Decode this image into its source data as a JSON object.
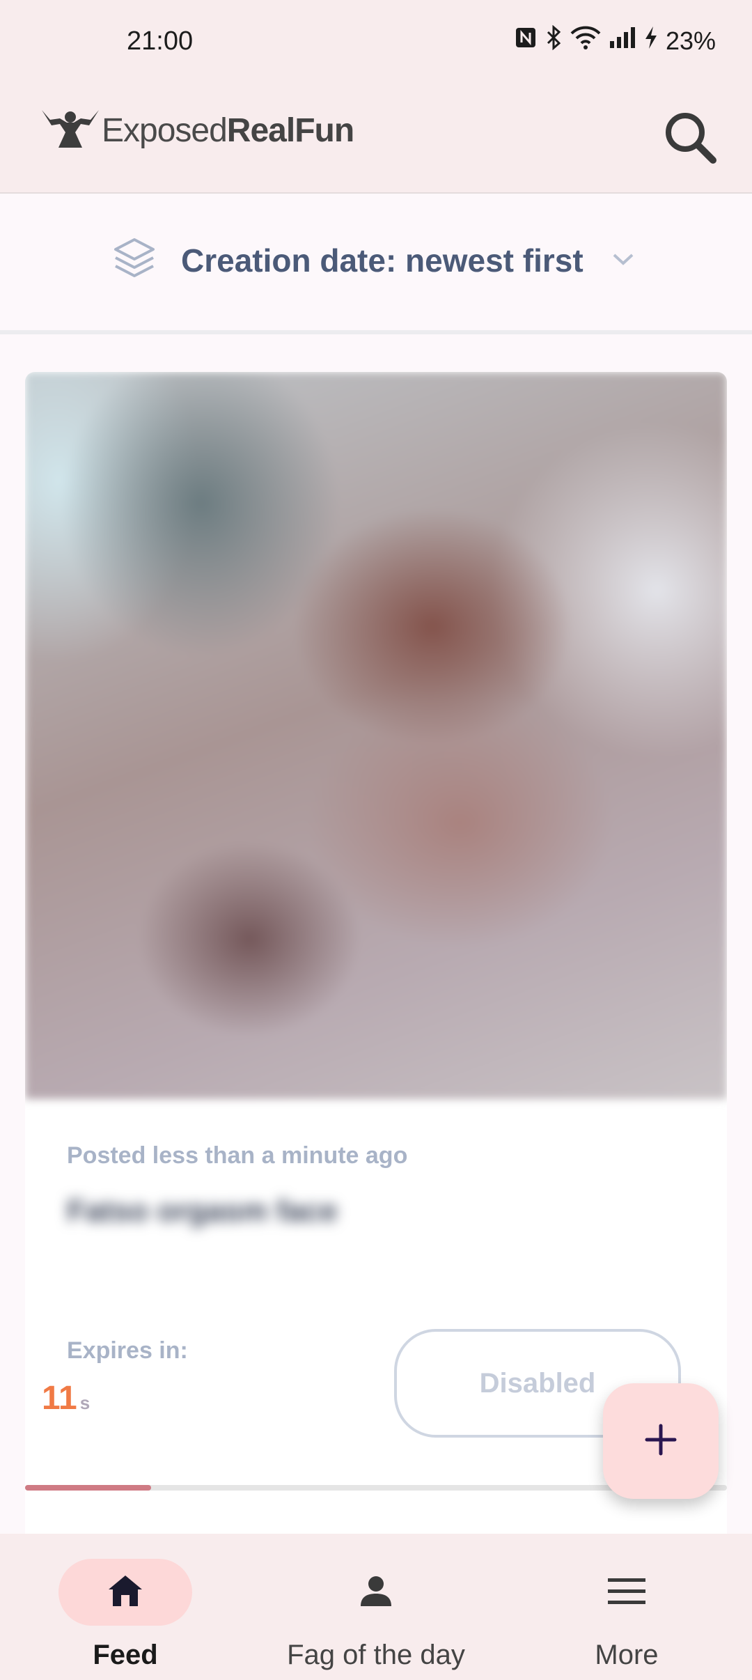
{
  "status_bar": {
    "time": "21:00",
    "battery": "23%",
    "icons": [
      "nfc-icon",
      "bluetooth-icon",
      "wifi-icon",
      "signal-icon",
      "charging-icon"
    ]
  },
  "app_bar": {
    "logo_text_regular": "Exposed",
    "logo_text_bold": "RealFun",
    "search_icon": "search-icon"
  },
  "sort": {
    "label": "Creation date: newest first",
    "icon": "layers-icon"
  },
  "post": {
    "posted": "Posted less than a minute ago",
    "title": "Fatso orgasm face",
    "expires_label": "Expires in:",
    "countdown_value": "11",
    "countdown_unit": "s",
    "action_label": "Disabled",
    "progress_fraction": 0.18
  },
  "fab": {
    "icon": "plus-icon"
  },
  "bottom_nav": {
    "items": [
      {
        "label": "Feed",
        "icon": "home-icon",
        "active": true
      },
      {
        "label": "Fag of the day",
        "icon": "person-icon",
        "active": false
      },
      {
        "label": "More",
        "icon": "menu-icon",
        "active": false
      }
    ]
  },
  "colors": {
    "app_bar_bg": "#f8eced",
    "accent_pink": "#fdd8d8",
    "countdown": "#f07a45",
    "progress": "#cf7b84",
    "sort_text": "#4b5a78"
  }
}
